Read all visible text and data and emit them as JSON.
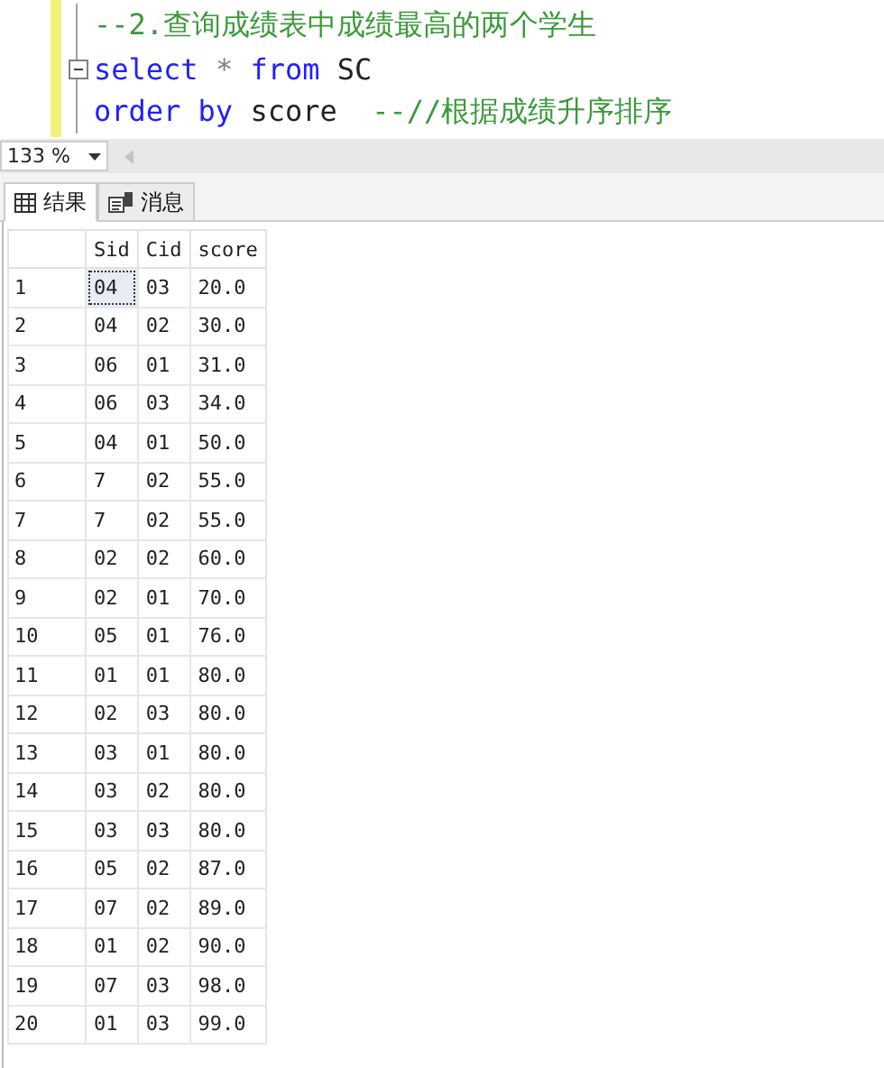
{
  "editor": {
    "lines": [
      {
        "fold_box": false,
        "tokens": [
          {
            "kind": "comment",
            "text": "--2.查询成绩表中成绩最高的两个学生"
          }
        ]
      },
      {
        "fold_box": true,
        "tokens": [
          {
            "kind": "keyword",
            "text": "select"
          },
          {
            "kind": "operator",
            "text": "*"
          },
          {
            "kind": "keyword",
            "text": "from"
          },
          {
            "kind": "plain",
            "text": "SC"
          }
        ]
      },
      {
        "fold_box": false,
        "tokens": [
          {
            "kind": "keyword",
            "text": "order by"
          },
          {
            "kind": "plain",
            "text": "score"
          },
          {
            "kind": "comment",
            "text": " --//根据成绩升序排序"
          }
        ]
      }
    ]
  },
  "zoom": {
    "value": "133 %"
  },
  "tabs": [
    {
      "label": "结果",
      "kind": "results",
      "selected": true
    },
    {
      "label": "消息",
      "kind": "messages",
      "selected": false
    }
  ],
  "table": {
    "columns": [
      "Sid",
      "Cid",
      "score"
    ],
    "rows": [
      {
        "number": "1",
        "cells": [
          {
            "text": "04",
            "selected": true
          },
          {
            "text": "03",
            "selected": false
          },
          {
            "text": "20.0",
            "selected": false
          }
        ]
      },
      {
        "number": "2",
        "cells": [
          {
            "text": "04",
            "selected": false
          },
          {
            "text": "02",
            "selected": false
          },
          {
            "text": "30.0",
            "selected": false
          }
        ]
      },
      {
        "number": "3",
        "cells": [
          {
            "text": "06",
            "selected": false
          },
          {
            "text": "01",
            "selected": false
          },
          {
            "text": "31.0",
            "selected": false
          }
        ]
      },
      {
        "number": "4",
        "cells": [
          {
            "text": "06",
            "selected": false
          },
          {
            "text": "03",
            "selected": false
          },
          {
            "text": "34.0",
            "selected": false
          }
        ]
      },
      {
        "number": "5",
        "cells": [
          {
            "text": "04",
            "selected": false
          },
          {
            "text": "01",
            "selected": false
          },
          {
            "text": "50.0",
            "selected": false
          }
        ]
      },
      {
        "number": "6",
        "cells": [
          {
            "text": "7",
            "selected": false
          },
          {
            "text": "02",
            "selected": false
          },
          {
            "text": "55.0",
            "selected": false
          }
        ]
      },
      {
        "number": "7",
        "cells": [
          {
            "text": "7",
            "selected": false
          },
          {
            "text": "02",
            "selected": false
          },
          {
            "text": "55.0",
            "selected": false
          }
        ]
      },
      {
        "number": "8",
        "cells": [
          {
            "text": "02",
            "selected": false
          },
          {
            "text": "02",
            "selected": false
          },
          {
            "text": "60.0",
            "selected": false
          }
        ]
      },
      {
        "number": "9",
        "cells": [
          {
            "text": "02",
            "selected": false
          },
          {
            "text": "01",
            "selected": false
          },
          {
            "text": "70.0",
            "selected": false
          }
        ]
      },
      {
        "number": "10",
        "cells": [
          {
            "text": "05",
            "selected": false
          },
          {
            "text": "01",
            "selected": false
          },
          {
            "text": "76.0",
            "selected": false
          }
        ]
      },
      {
        "number": "11",
        "cells": [
          {
            "text": "01",
            "selected": false
          },
          {
            "text": "01",
            "selected": false
          },
          {
            "text": "80.0",
            "selected": false
          }
        ]
      },
      {
        "number": "12",
        "cells": [
          {
            "text": "02",
            "selected": false
          },
          {
            "text": "03",
            "selected": false
          },
          {
            "text": "80.0",
            "selected": false
          }
        ]
      },
      {
        "number": "13",
        "cells": [
          {
            "text": "03",
            "selected": false
          },
          {
            "text": "01",
            "selected": false
          },
          {
            "text": "80.0",
            "selected": false
          }
        ]
      },
      {
        "number": "14",
        "cells": [
          {
            "text": "03",
            "selected": false
          },
          {
            "text": "02",
            "selected": false
          },
          {
            "text": "80.0",
            "selected": false
          }
        ]
      },
      {
        "number": "15",
        "cells": [
          {
            "text": "03",
            "selected": false
          },
          {
            "text": "03",
            "selected": false
          },
          {
            "text": "80.0",
            "selected": false
          }
        ]
      },
      {
        "number": "16",
        "cells": [
          {
            "text": "05",
            "selected": false
          },
          {
            "text": "02",
            "selected": false
          },
          {
            "text": "87.0",
            "selected": false
          }
        ]
      },
      {
        "number": "17",
        "cells": [
          {
            "text": "07",
            "selected": false
          },
          {
            "text": "02",
            "selected": false
          },
          {
            "text": "89.0",
            "selected": false
          }
        ]
      },
      {
        "number": "18",
        "cells": [
          {
            "text": "01",
            "selected": false
          },
          {
            "text": "02",
            "selected": false
          },
          {
            "text": "90.0",
            "selected": false
          }
        ]
      },
      {
        "number": "19",
        "cells": [
          {
            "text": "07",
            "selected": false
          },
          {
            "text": "03",
            "selected": false
          },
          {
            "text": "98.0",
            "selected": false
          }
        ]
      },
      {
        "number": "20",
        "cells": [
          {
            "text": "01",
            "selected": false
          },
          {
            "text": "03",
            "selected": false
          },
          {
            "text": "99.0",
            "selected": false
          }
        ]
      }
    ]
  }
}
